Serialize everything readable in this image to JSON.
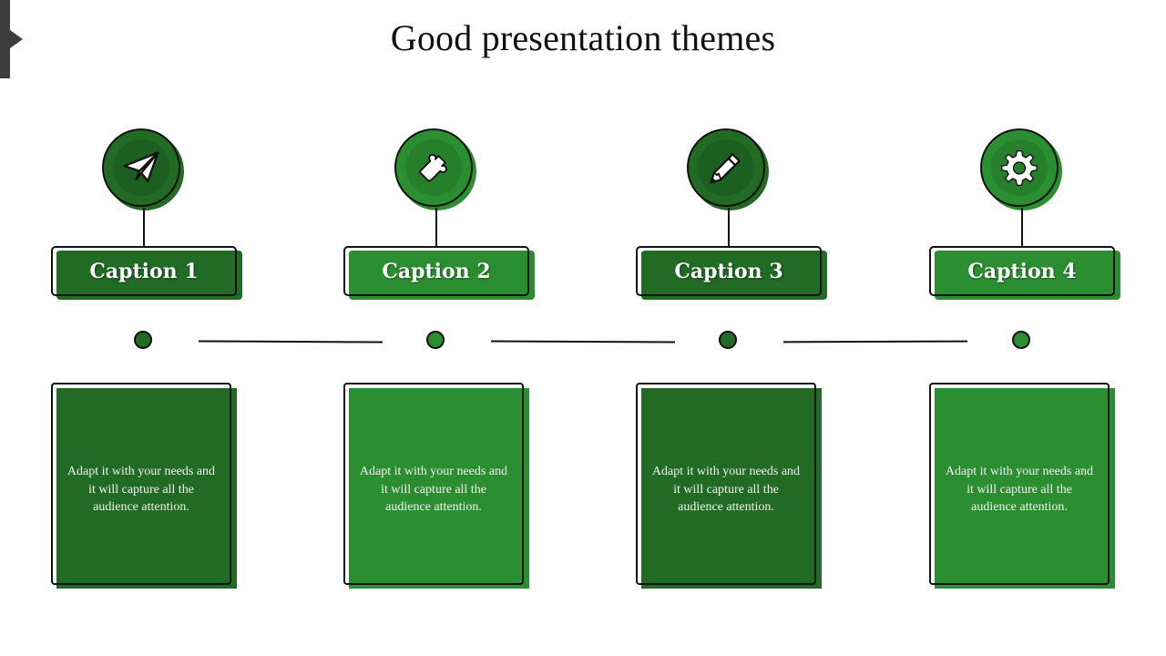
{
  "slide": {
    "title": "Good presentation themes",
    "colors": {
      "dark_green": "#216b24",
      "light_green": "#2b8f31",
      "outline": "#111111",
      "corner_tab": "#3d3d3d"
    }
  },
  "steps": [
    {
      "caption": "Caption 1",
      "icon": "paper-plane-icon",
      "tone": "dark",
      "text": "Adapt it with your needs and it will capture all the audience attention."
    },
    {
      "caption": "Caption 2",
      "icon": "puzzle-piece-icon",
      "tone": "light",
      "text": "Adapt it with your needs and it will capture all the audience attention."
    },
    {
      "caption": "Caption 3",
      "icon": "pencil-icon",
      "tone": "dark",
      "text": "Adapt it with your needs and it will capture all the audience attention."
    },
    {
      "caption": "Caption 4",
      "icon": "gear-icon",
      "tone": "light",
      "text": "Adapt it with your needs and it will capture all the audience attention."
    }
  ]
}
